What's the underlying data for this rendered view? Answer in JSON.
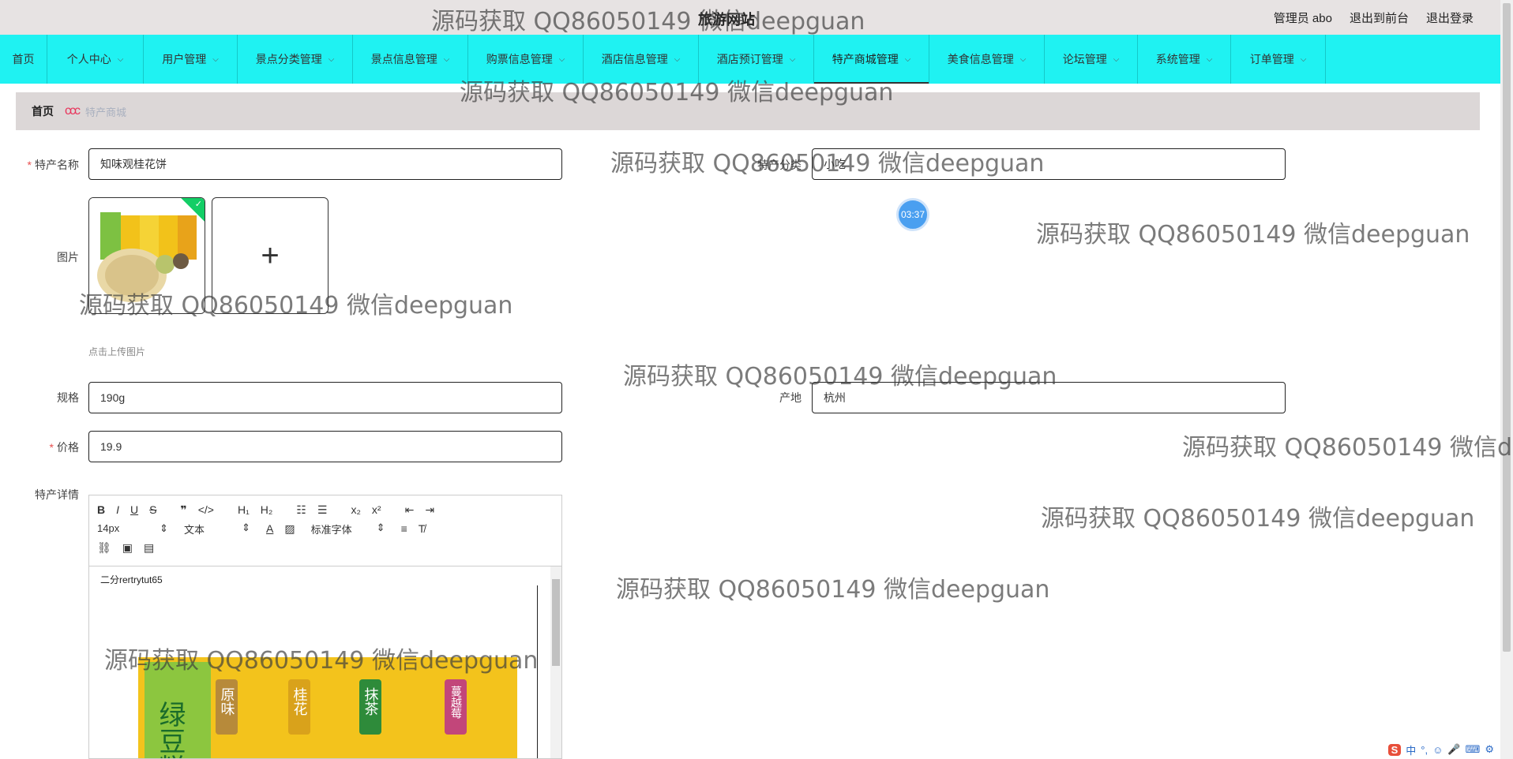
{
  "topbar": {
    "title": "旅游网站",
    "admin_label": "管理员 abo",
    "to_front_label": "退出到前台",
    "logout_label": "退出登录"
  },
  "nav": {
    "items": [
      {
        "label": "首页",
        "has_menu": false
      },
      {
        "label": "个人中心",
        "has_menu": true
      },
      {
        "label": "用户管理",
        "has_menu": true
      },
      {
        "label": "景点分类管理",
        "has_menu": true
      },
      {
        "label": "景点信息管理",
        "has_menu": true
      },
      {
        "label": "购票信息管理",
        "has_menu": true
      },
      {
        "label": "酒店信息管理",
        "has_menu": true
      },
      {
        "label": "酒店预订管理",
        "has_menu": true
      },
      {
        "label": "特产商城管理",
        "has_menu": true,
        "active": true
      },
      {
        "label": "美食信息管理",
        "has_menu": true
      },
      {
        "label": "论坛管理",
        "has_menu": true
      },
      {
        "label": "系统管理",
        "has_menu": true
      },
      {
        "label": "订单管理",
        "has_menu": true
      }
    ]
  },
  "breadcrumb": {
    "home": "首页",
    "separator": "ccc",
    "current": "特产商城"
  },
  "form": {
    "name_label": "特产名称",
    "name_value": "知味观桂花饼",
    "category_label": "特产分类",
    "category_value": "小吃",
    "image_label": "图片",
    "image_alt": "绿豆糕 知味观",
    "upload_tip": "点击上传图片",
    "spec_label": "规格",
    "spec_value": "190g",
    "origin_label": "产地",
    "origin_value": "杭州",
    "price_label": "价格",
    "price_value": "19.9",
    "detail_label": "特产详情"
  },
  "editor": {
    "font_size": "14px",
    "block_type": "文本",
    "font_family": "标准字体",
    "content_text": "二分rertrytut65",
    "image_labels": [
      "绿豆糕",
      "原味",
      "桂花",
      "抹茶",
      "蔓越莓"
    ]
  },
  "timer": "03:37",
  "watermark": "源码获取 QQ86050149 微信deepguan",
  "ime": {
    "lang": "中"
  },
  "colors": {
    "nav_bg": "#1ff2f2",
    "topbar_bg": "#e7e3e3",
    "breadcrumb_bg": "#dcd7d7",
    "required": "#e84f4f",
    "success": "#13ce66"
  }
}
